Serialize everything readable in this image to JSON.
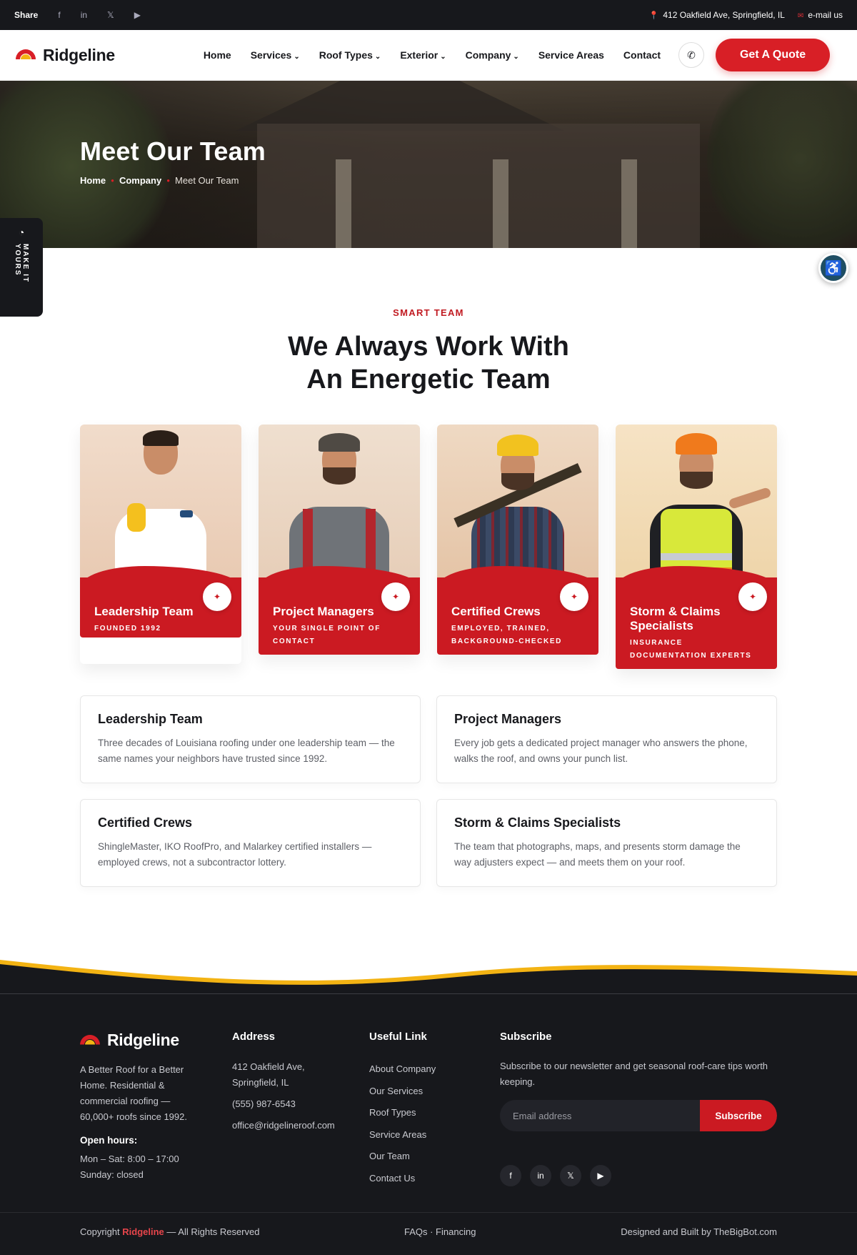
{
  "topbar": {
    "share_label": "Share",
    "social": [
      "f",
      "in",
      "𝕏",
      "▶"
    ],
    "address": "412 Oakfield Ave, Springfield, IL",
    "email": "e-mail us"
  },
  "nav": {
    "logo": "Ridgeline",
    "items": [
      {
        "label": "Home",
        "caret": ""
      },
      {
        "label": "Services",
        "caret": "⌄"
      },
      {
        "label": "Roof Types",
        "caret": "⌄"
      },
      {
        "label": "Exterior",
        "caret": "⌄"
      },
      {
        "label": "Company",
        "caret": "⌄"
      },
      {
        "label": "Service Areas",
        "caret": ""
      },
      {
        "label": "Contact",
        "caret": ""
      }
    ],
    "cta": "Get A Quote"
  },
  "hero": {
    "title": "Meet Our Team",
    "breadcrumb": [
      "Home",
      "Company",
      "Meet Our Team"
    ]
  },
  "side_tab": {
    "label": "MAKE IT YOURS"
  },
  "section": {
    "eyebrow": "SMART TEAM",
    "title_line1": "We Always Work With",
    "title_line2": "An Energetic Team"
  },
  "cards": [
    {
      "title": "Leadership Team",
      "subtitle": "FOUNDED 1992"
    },
    {
      "title": "Project Managers",
      "subtitle": "YOUR SINGLE POINT OF CONTACT"
    },
    {
      "title": "Certified Crews",
      "subtitle": "EMPLOYED, TRAINED, BACKGROUND-CHECKED"
    },
    {
      "title": "Storm & Claims Specialists",
      "subtitle": "INSURANCE DOCUMENTATION EXPERTS"
    }
  ],
  "info": [
    {
      "title": "Leadership Team",
      "text": "Three decades of Louisiana roofing under one leadership team — the same names your neighbors have trusted since 1992."
    },
    {
      "title": "Project Managers",
      "text": "Every job gets a dedicated project manager who answers the phone, walks the roof, and owns your punch list."
    },
    {
      "title": "Certified Crews",
      "text": "ShingleMaster, IKO RoofPro, and Malarkey certified installers — employed crews, not a subcontractor lottery."
    },
    {
      "title": "Storm & Claims Specialists",
      "text": "The team that photographs, maps, and presents storm damage the way adjusters expect — and meets them on your roof."
    }
  ],
  "footer": {
    "logo": "Ridgeline",
    "tagline": "A Better Roof for a Better Home. Residential & commercial roofing — 60,000+ roofs since 1992.",
    "hours_heading": "Open hours:",
    "hours_line1": "Mon – Sat: 8:00 – 17:00",
    "hours_line2": "Sunday: closed",
    "address_heading": "Address",
    "address": "412 Oakfield Ave, Springfield, IL",
    "phone": "(555) 987-6543",
    "email": "office@ridgelineroof.com",
    "links_heading": "Useful Link",
    "links": [
      "About Company",
      "Our Services",
      "Roof Types",
      "Service Areas",
      "Our Team",
      "Contact Us"
    ],
    "subscribe_heading": "Subscribe",
    "subscribe_text": "Subscribe to our newsletter and get seasonal roof-care tips worth keeping.",
    "email_placeholder": "Email address",
    "subscribe_button": "Subscribe",
    "social": [
      "f",
      "in",
      "𝕏",
      "▶"
    ],
    "copyright_prefix": "Copyright",
    "copyright_brand": "Ridgeline",
    "copyright_suffix": "— All Rights Reserved",
    "middle_links": "FAQs · Financing",
    "credit": "Designed and Built by TheBigBot.com"
  },
  "colors": {
    "brand_red": "#d81f26",
    "brand_yellow": "#f3b313",
    "dark": "#17181c"
  }
}
